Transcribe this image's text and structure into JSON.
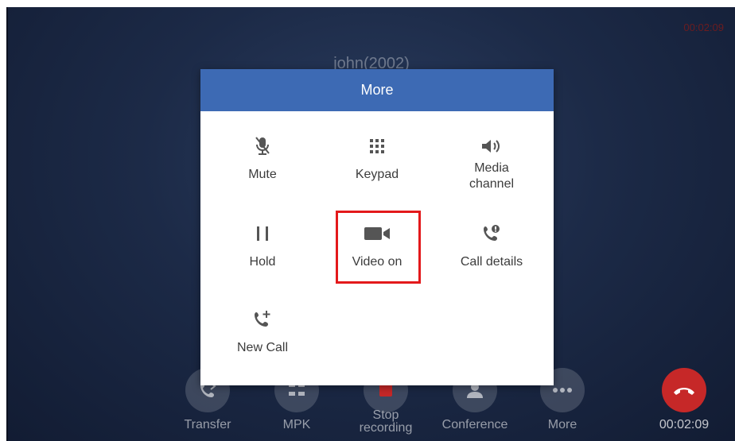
{
  "call": {
    "top_timer": "00:02:09",
    "caller_name": "john(2002)",
    "duration": "00:02:09"
  },
  "actions": [
    {
      "id": "transfer",
      "label": "Transfer",
      "icon": "transfer-icon"
    },
    {
      "id": "mpk",
      "label": "MPK",
      "icon": "mpk-grid-icon"
    },
    {
      "id": "stop-recording",
      "label": "Stop recording",
      "icon": "record-stop-icon"
    },
    {
      "id": "conference",
      "label": "Conference",
      "icon": "conference-icon"
    },
    {
      "id": "more",
      "label": "More",
      "icon": "more-dots-icon"
    }
  ],
  "more_dialog": {
    "title": "More",
    "items": [
      {
        "label": "Mute",
        "icon": "mute-mic-icon"
      },
      {
        "label": "Keypad",
        "icon": "keypad-icon"
      },
      {
        "label": "Media channel",
        "icon": "speaker-icon"
      },
      {
        "label": "Hold",
        "icon": "pause-icon"
      },
      {
        "label": "Video on",
        "icon": "video-camera-icon"
      },
      {
        "label": "Call details",
        "icon": "call-details-icon"
      },
      {
        "label": "New Call",
        "icon": "add-call-icon"
      }
    ]
  },
  "colors": {
    "dialog_header": "#3d6ab4",
    "highlight": "#e3191b",
    "hangup": "#c62828"
  }
}
